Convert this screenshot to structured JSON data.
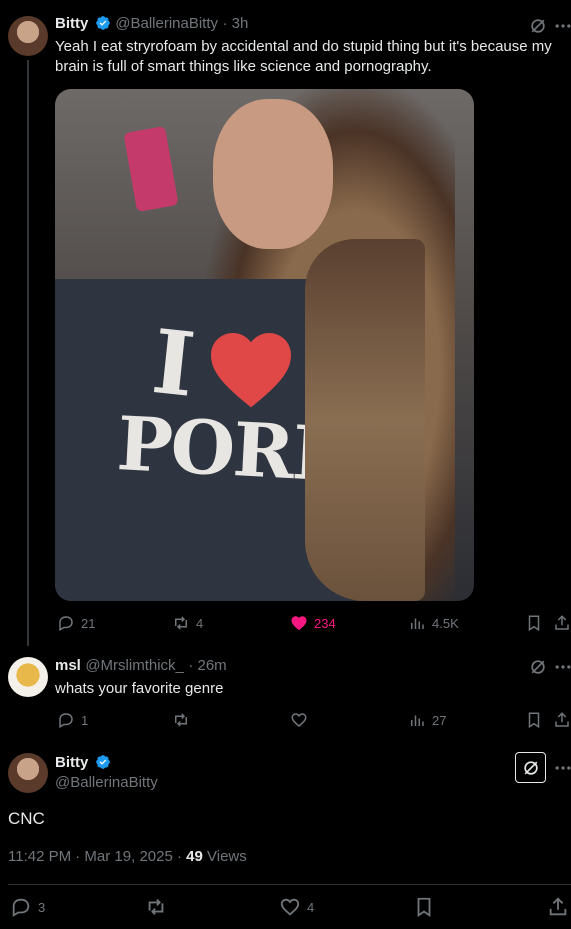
{
  "post1": {
    "name": "Bitty",
    "handle": "@BallerinaBitty",
    "time": "· 3h",
    "text": "Yeah I eat stryrofoam by accidental and do stupid thing but it's because my brain is full of smart things like science and pornography.",
    "shirt_top": "I",
    "shirt_bottom": "PORN",
    "actions": {
      "replies": "21",
      "reposts": "4",
      "likes": "234",
      "views": "4.5K"
    }
  },
  "post2": {
    "name": "msl",
    "handle": "@Mrslimthick_",
    "time": "· 26m",
    "text": "whats your favorite genre",
    "actions": {
      "replies": "1",
      "reposts": "",
      "likes": "",
      "views": "27"
    }
  },
  "post3": {
    "name": "Bitty",
    "handle": "@BallerinaBitty",
    "text": "CNC",
    "timestamp": "11:42 PM · Mar 19, 2025 ·",
    "views_count": "49",
    "views_label": "Views",
    "actions": {
      "replies": "3",
      "reposts": "",
      "likes": "4"
    }
  },
  "colors": {
    "accent": "#1d9bf0",
    "like": "#f91880",
    "muted": "#71767b",
    "text": "#e7e9ea"
  }
}
